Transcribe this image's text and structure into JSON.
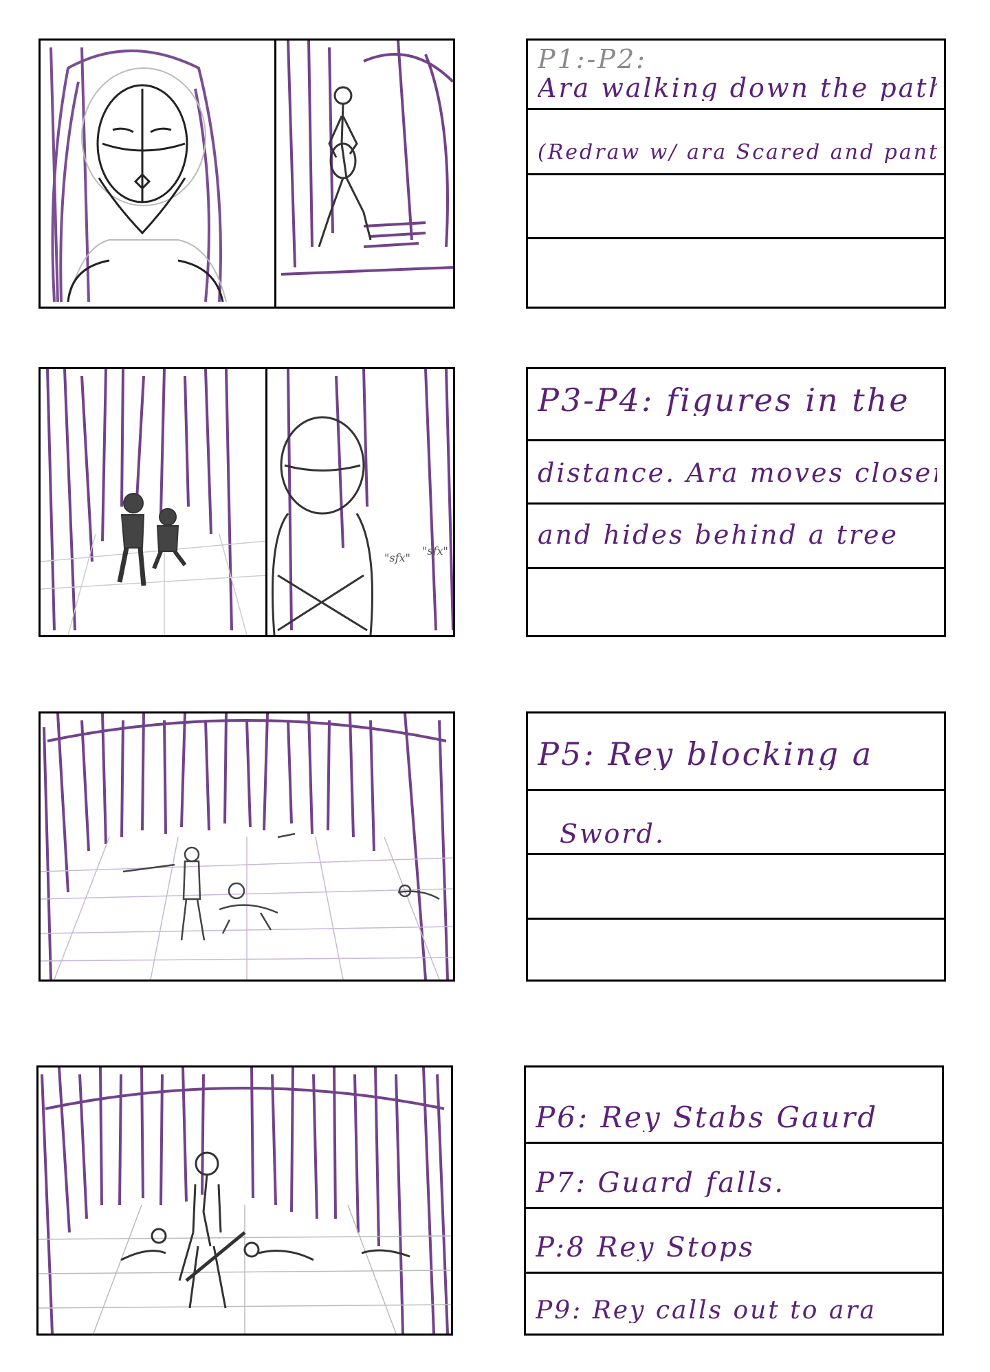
{
  "storyboard": {
    "rows": [
      {
        "lines": [
          "P1:-P2:",
          "Ara walking down the path",
          "(Redraw w/ ara Scared and panting)",
          ""
        ],
        "panels": 2
      },
      {
        "lines": [
          "P3-P4: figures in the",
          "distance. Ara moves closer",
          "and hides behind a tree",
          ""
        ],
        "panels": 2,
        "sfx": [
          "\"sfx\"",
          "\"sfx\""
        ]
      },
      {
        "lines": [
          "P5: Rey blocking a",
          "Sword.",
          "",
          ""
        ],
        "panels": 1
      },
      {
        "lines": [
          "P6: Rey Stabs Gaurd",
          "P7: Guard falls.",
          "P:8 Rey Stops",
          "P9: Rey calls out to ara"
        ],
        "panels": 1
      }
    ]
  },
  "colors": {
    "ink": "#000000",
    "purple": "#5a2277",
    "sketch": "#555555"
  }
}
